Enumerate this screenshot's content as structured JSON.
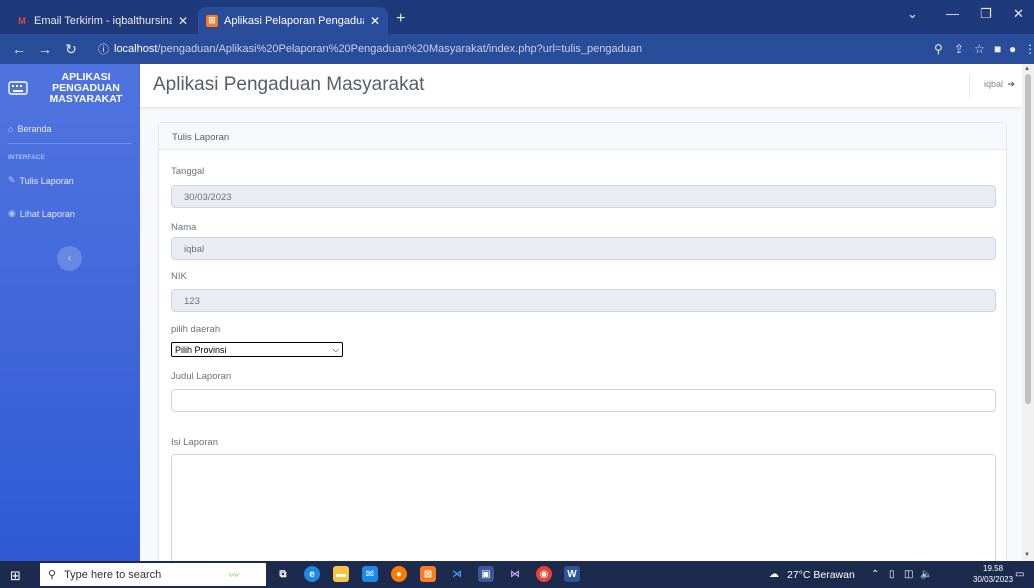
{
  "browser": {
    "tabs": [
      {
        "title": "Email Terkirim - iqbalthursina@g",
        "icon": "gmail-icon"
      },
      {
        "title": "Aplikasi Pelaporan Pengaduan M",
        "icon": "xampp-icon"
      }
    ],
    "url_host": "localhost",
    "url_path": "/pengaduan/Aplikasi%20Pelaporan%20Pengaduan%20Masyarakat/index.php?url=tulis_pengaduan"
  },
  "sidebar": {
    "brand": "APLIKASI PENGADUAN MASYARAKAT",
    "items": [
      {
        "label": "Beranda",
        "icon": "home-icon"
      },
      {
        "label": "Tulis Laporan",
        "icon": "edit-icon"
      },
      {
        "label": "Lihat Laporan",
        "icon": "eye-icon"
      }
    ],
    "heading": "INTERFACE",
    "toggle": "‹"
  },
  "topbar": {
    "title": "Aplikasi Pengaduan Masyarakat",
    "user": "iqbal"
  },
  "card": {
    "header": "Tulis Laporan",
    "fields": {
      "tanggal_label": "Tanggal",
      "tanggal_value": "30/03/2023",
      "nama_label": "Nama",
      "nama_value": "iqbal",
      "nik_label": "NIK",
      "nik_value": "123",
      "daerah_label": "pilih daerah",
      "daerah_value": "Pilih Provinsi",
      "judul_label": "Judul Laporan",
      "judul_value": "",
      "isi_label": "Isi Laporan"
    }
  },
  "taskbar": {
    "search_placeholder": "Type here to search",
    "weather": "27°C Berawan",
    "time": "19.58",
    "date": "30/03/2023"
  }
}
